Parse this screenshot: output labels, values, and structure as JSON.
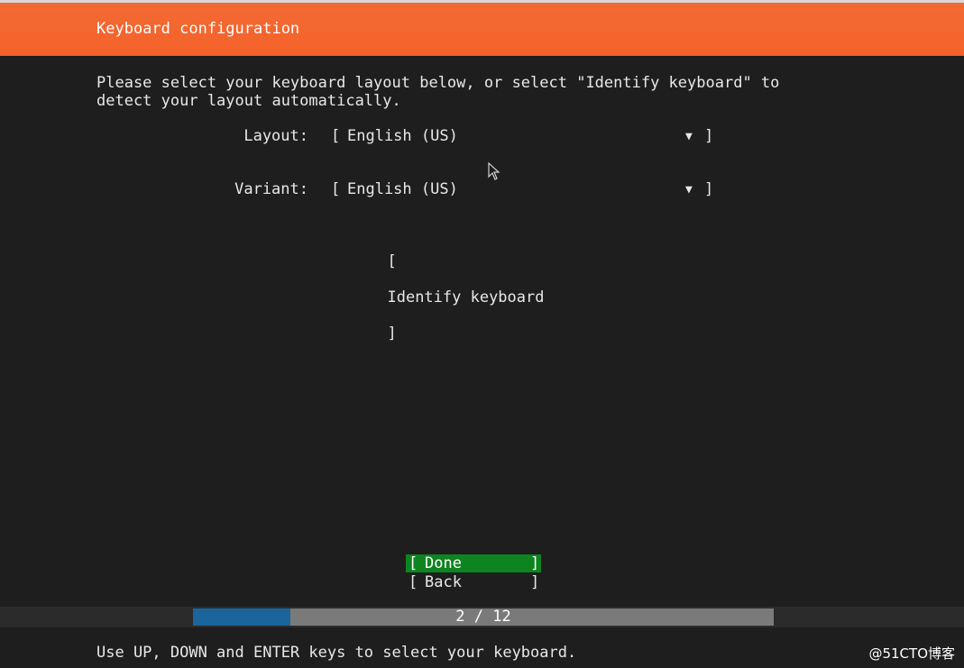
{
  "header": {
    "title": "Keyboard configuration"
  },
  "intro": {
    "text": "Please select your keyboard layout below, or select \"Identify keyboard\" to\ndetect your layout automatically."
  },
  "layout_field": {
    "label": "Layout:",
    "value": "English (US)"
  },
  "variant_field": {
    "label": "Variant:",
    "value": "English (US)"
  },
  "identify": {
    "label": "Identify keyboard"
  },
  "buttons": {
    "done_label": "Done",
    "back_label": "Back"
  },
  "progress": {
    "text": "2 / 12",
    "current": 2,
    "total": 12,
    "fraction": 0.167
  },
  "footer": {
    "help": "Use UP, DOWN and ENTER keys to select your keyboard."
  },
  "watermark": {
    "text": "@51CTO博客"
  },
  "brackets": {
    "open": "[",
    "close": "]"
  },
  "icons": {
    "dropdown": "▼"
  },
  "colors": {
    "header": "#f4622a",
    "background": "#1e1e1e",
    "selected_button": "#0e8420",
    "progress_fill": "#19659c",
    "progress_track": "#7a7a7a"
  }
}
